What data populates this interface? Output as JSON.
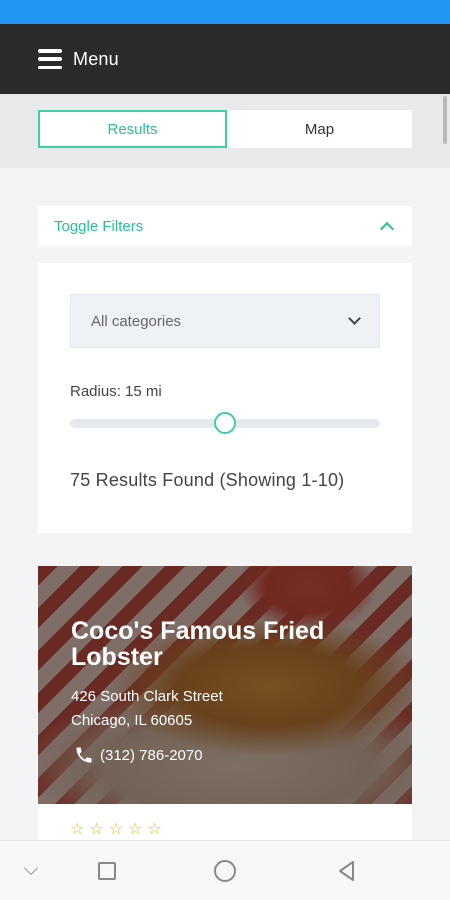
{
  "header": {
    "menu_label": "Menu"
  },
  "view_toggle": {
    "tabs": [
      {
        "label": "Results",
        "active": true
      },
      {
        "label": "Map",
        "active": false
      }
    ]
  },
  "filters": {
    "toggle_label": "Toggle Filters",
    "category_select": {
      "value": "All categories"
    },
    "radius_label": "Radius: 15 mi",
    "radius_slider_fraction": 0.5,
    "results_text": "75 Results Found (Showing 1-10)"
  },
  "listing": {
    "title": "Coco's Famous Fried Lobster",
    "street": "426 South Clark Street",
    "city_line": "Chicago, IL 60605",
    "phone": "(312) 786-2070",
    "rating_stars_total": 5,
    "rating_stars_filled": 0
  },
  "colors": {
    "status_bar": "#2196f3",
    "header_bg": "#2b2b2b",
    "accent": "#3ecfa6",
    "star": "#f5b400"
  },
  "icons": [
    "menu-icon",
    "chevron-up-icon",
    "chevron-down-icon",
    "phone-icon",
    "star-outline-icon",
    "nav-collapse-icon",
    "recents-icon",
    "home-icon",
    "back-icon"
  ]
}
